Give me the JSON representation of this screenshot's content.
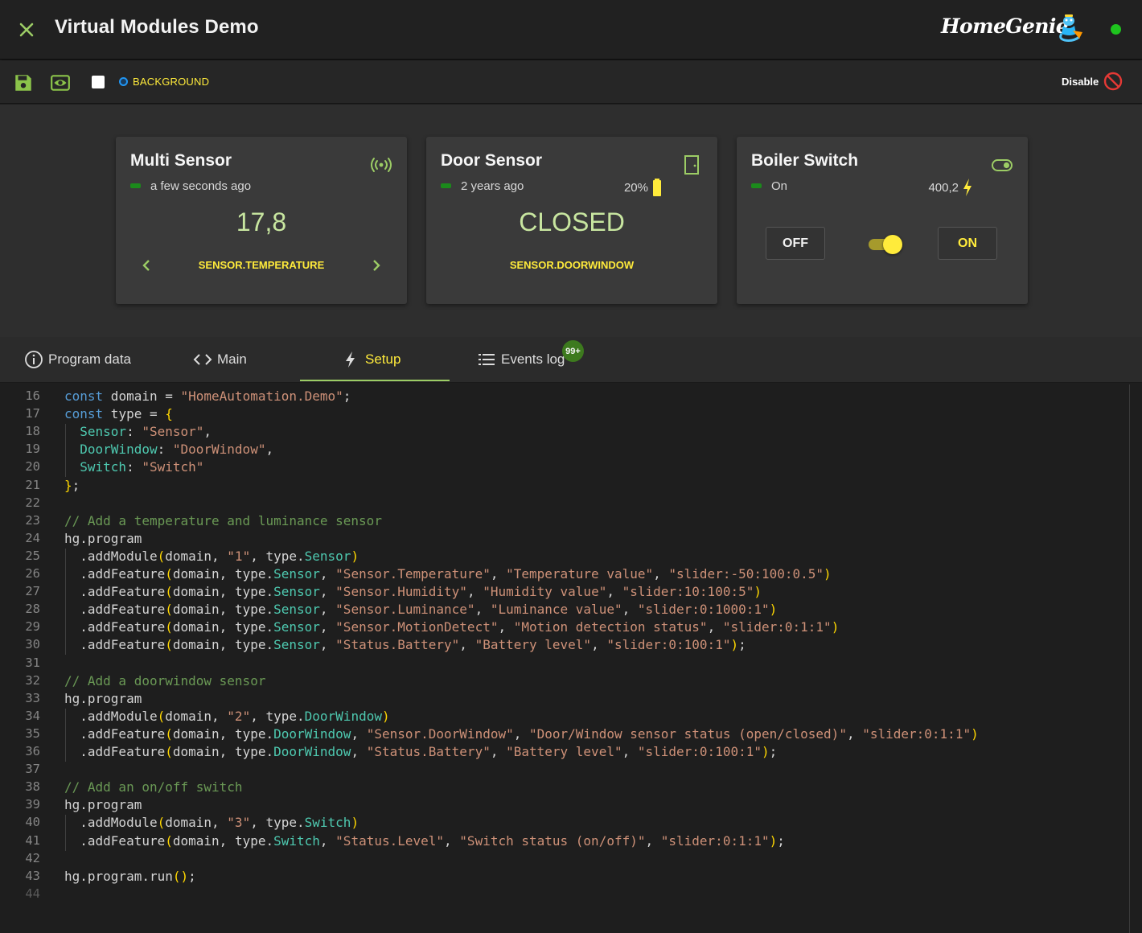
{
  "header": {
    "title": "Virtual Modules Demo",
    "brand": "HomeGenie",
    "status_color": "#1ec41e"
  },
  "toolbar": {
    "save_icon": "save-icon",
    "preview_icon": "eye-icon",
    "background_label": "BACKGROUND",
    "disable_label": "Disable"
  },
  "cards": [
    {
      "title": "Multi Sensor",
      "icon": "radio-waves-icon",
      "status": "a few seconds ago",
      "value": "17,8",
      "field": "SENSOR.TEMPERATURE"
    },
    {
      "title": "Door Sensor",
      "icon": "door-icon",
      "status": "2 years ago",
      "battery": "20%",
      "value": "CLOSED",
      "field": "SENSOR.DOORWINDOW"
    },
    {
      "title": "Boiler Switch",
      "icon": "toggle-switch-icon",
      "status": "On",
      "power": "400,2",
      "off_label": "OFF",
      "on_label": "ON",
      "switch_level": 1
    }
  ],
  "tabs": [
    {
      "label": "Program data",
      "icon": "info-icon"
    },
    {
      "label": "Main",
      "icon": "code-icon"
    },
    {
      "label": "Setup",
      "icon": "lightning-icon",
      "active": true
    },
    {
      "label": "Events log",
      "icon": "list-icon",
      "badge": "99+"
    }
  ],
  "editor": {
    "lines": [
      {
        "n": "16",
        "html": "<span class='k'>const</span> domain = <span class='s'>\"HomeAutomation.Demo\"</span>;"
      },
      {
        "n": "17",
        "html": "<span class='k'>const</span> type = <span class='p'>{</span>"
      },
      {
        "n": "18",
        "html": "  <span class='t'>Sensor</span>: <span class='s'>\"Sensor\"</span>,"
      },
      {
        "n": "19",
        "html": "  <span class='t'>DoorWindow</span>: <span class='s'>\"DoorWindow\"</span>,"
      },
      {
        "n": "20",
        "html": "  <span class='t'>Switch</span>: <span class='s'>\"Switch\"</span>"
      },
      {
        "n": "21",
        "html": "<span class='p'>}</span>;"
      },
      {
        "n": "22",
        "html": ""
      },
      {
        "n": "23",
        "html": "<span class='c'>// Add a temperature and luminance sensor</span>"
      },
      {
        "n": "24",
        "html": "hg.program"
      },
      {
        "n": "25",
        "html": "  .addModule<span class='p'>(</span>domain, <span class='s'>\"1\"</span>, type.<span class='t'>Sensor</span><span class='p'>)</span>"
      },
      {
        "n": "26",
        "html": "  .addFeature<span class='p'>(</span>domain, type.<span class='t'>Sensor</span>, <span class='s'>\"Sensor.Temperature\"</span>, <span class='s'>\"Temperature value\"</span>, <span class='s'>\"slider:-50:100:0.5\"</span><span class='p'>)</span>"
      },
      {
        "n": "27",
        "html": "  .addFeature<span class='p'>(</span>domain, type.<span class='t'>Sensor</span>, <span class='s'>\"Sensor.Humidity\"</span>, <span class='s'>\"Humidity value\"</span>, <span class='s'>\"slider:10:100:5\"</span><span class='p'>)</span>"
      },
      {
        "n": "28",
        "html": "  .addFeature<span class='p'>(</span>domain, type.<span class='t'>Sensor</span>, <span class='s'>\"Sensor.Luminance\"</span>, <span class='s'>\"Luminance value\"</span>, <span class='s'>\"slider:0:1000:1\"</span><span class='p'>)</span>"
      },
      {
        "n": "29",
        "html": "  .addFeature<span class='p'>(</span>domain, type.<span class='t'>Sensor</span>, <span class='s'>\"Sensor.MotionDetect\"</span>, <span class='s'>\"Motion detection status\"</span>, <span class='s'>\"slider:0:1:1\"</span><span class='p'>)</span>"
      },
      {
        "n": "30",
        "html": "  .addFeature<span class='p'>(</span>domain, type.<span class='t'>Sensor</span>, <span class='s'>\"Status.Battery\"</span>, <span class='s'>\"Battery level\"</span>, <span class='s'>\"slider:0:100:1\"</span><span class='p'>)</span>;"
      },
      {
        "n": "31",
        "html": ""
      },
      {
        "n": "32",
        "html": "<span class='c'>// Add a doorwindow sensor</span>"
      },
      {
        "n": "33",
        "html": "hg.program"
      },
      {
        "n": "34",
        "html": "  .addModule<span class='p'>(</span>domain, <span class='s'>\"2\"</span>, type.<span class='t'>DoorWindow</span><span class='p'>)</span>"
      },
      {
        "n": "35",
        "html": "  .addFeature<span class='p'>(</span>domain, type.<span class='t'>DoorWindow</span>, <span class='s'>\"Sensor.DoorWindow\"</span>, <span class='s'>\"Door/Window sensor status (open/closed)\"</span>, <span class='s'>\"slider:0:1:1\"</span><span class='p'>)</span>"
      },
      {
        "n": "36",
        "html": "  .addFeature<span class='p'>(</span>domain, type.<span class='t'>DoorWindow</span>, <span class='s'>\"Status.Battery\"</span>, <span class='s'>\"Battery level\"</span>, <span class='s'>\"slider:0:100:1\"</span><span class='p'>)</span>;"
      },
      {
        "n": "37",
        "html": ""
      },
      {
        "n": "38",
        "html": "<span class='c'>// Add an on/off switch</span>"
      },
      {
        "n": "39",
        "html": "hg.program"
      },
      {
        "n": "40",
        "html": "  .addModule<span class='p'>(</span>domain, <span class='s'>\"3\"</span>, type.<span class='t'>Switch</span><span class='p'>)</span>"
      },
      {
        "n": "41",
        "html": "  .addFeature<span class='p'>(</span>domain, type.<span class='t'>Switch</span>, <span class='s'>\"Status.Level\"</span>, <span class='s'>\"Switch status (on/off)\"</span>, <span class='s'>\"slider:0:1:1\"</span><span class='p'>)</span>;"
      },
      {
        "n": "42",
        "html": ""
      },
      {
        "n": "43",
        "html": "hg.program.run<span class='p'>()</span>;"
      },
      {
        "n": "44",
        "html": ""
      }
    ]
  }
}
